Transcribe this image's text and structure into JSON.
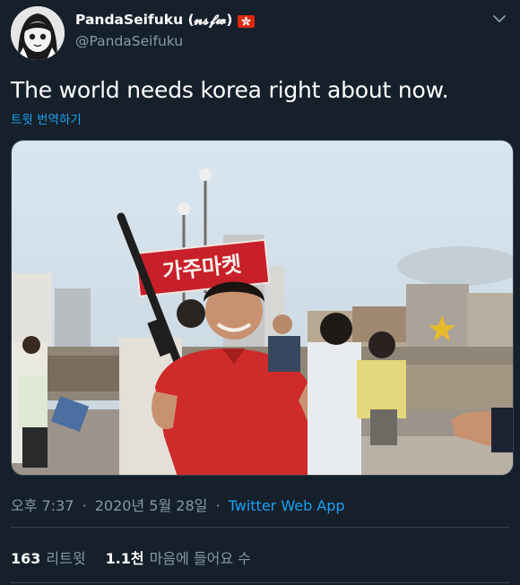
{
  "user": {
    "display_name": "PandaSeifuku (𝓷𝓼𝓯𝔀)",
    "handle": "@PandaSeifuku",
    "flag_icon": "hong-kong-flag-icon"
  },
  "tweet": {
    "text": "The world needs korea right about now.",
    "translate_link": "트윗 번역하기",
    "photo_sign_text": "가주마켓"
  },
  "meta": {
    "time": "오후 7:37",
    "date": "2020년 5월 28일",
    "separator": "·",
    "source": "Twitter Web App"
  },
  "stats": {
    "retweets_count": "163",
    "retweets_label": "리트윗",
    "likes_count": "1.1천",
    "likes_label": "마음에 들어요 수"
  },
  "colors": {
    "background": "#15202b",
    "accent": "#1da1f2",
    "secondary_text": "#8899a6",
    "divider": "#38444d"
  }
}
